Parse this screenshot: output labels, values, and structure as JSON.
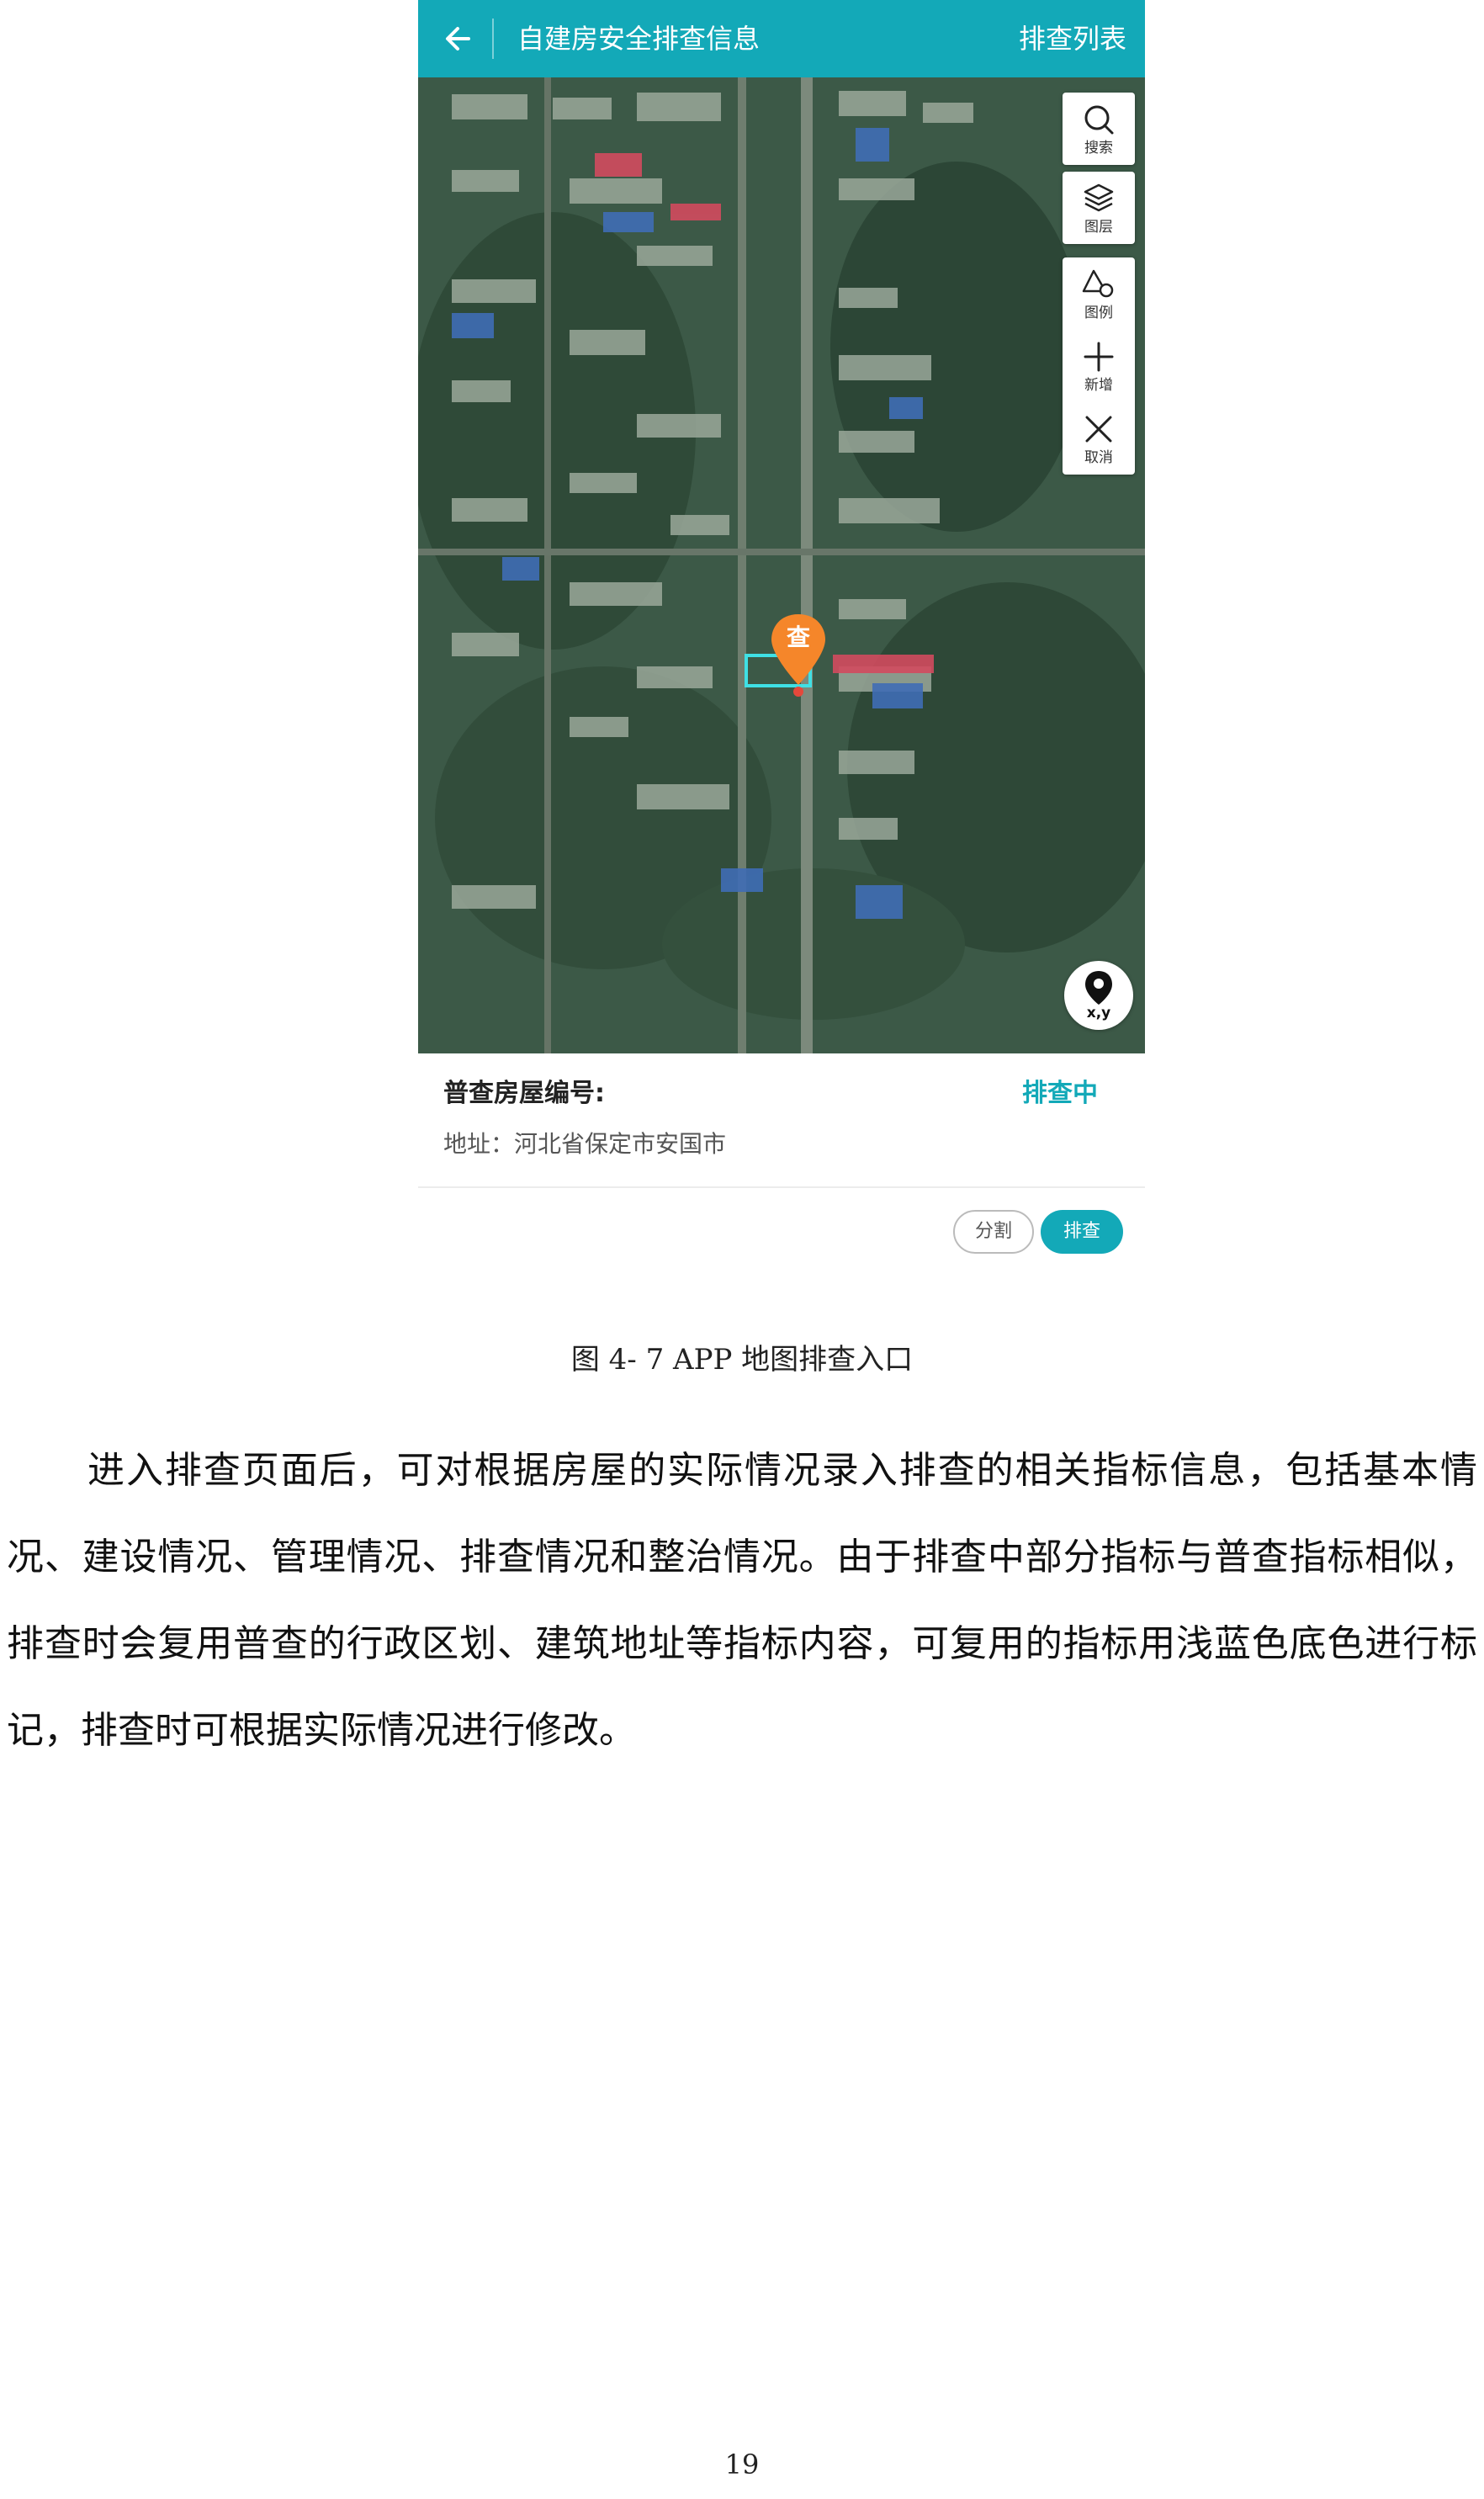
{
  "app": {
    "title": "自建房安全排查信息",
    "header_right": "排查列表",
    "accent_color": "#13a9b8"
  },
  "map": {
    "tools": [
      {
        "icon": "search-icon",
        "label": "搜索"
      },
      {
        "icon": "layers-icon",
        "label": "图层"
      },
      {
        "icon": "legend-icon",
        "label": "图例"
      },
      {
        "icon": "plus-icon",
        "label": "新增"
      },
      {
        "icon": "close-icon",
        "label": "取消"
      }
    ],
    "marker_label": "查",
    "xy_label": "x,y"
  },
  "info": {
    "code_label": "普查房屋编号:",
    "status": "排查中",
    "address": "地址：河北省保定市安国市",
    "split_button": "分割",
    "check_button": "排查"
  },
  "document": {
    "caption": "图 4- 7 APP 地图排查入口",
    "paragraph": "进入排查页面后，可对根据房屋的实际情况录入排查的相关指标信息，包括基本情况、建设情况、管理情况、排查情况和整治情况。由于排查中部分指标与普查指标相似，排查时会复用普查的行政区划、建筑地址等指标内容，可复用的指标用浅蓝色底色进行标记，排查时可根据实际情况进行修改。",
    "page_number": "19"
  }
}
